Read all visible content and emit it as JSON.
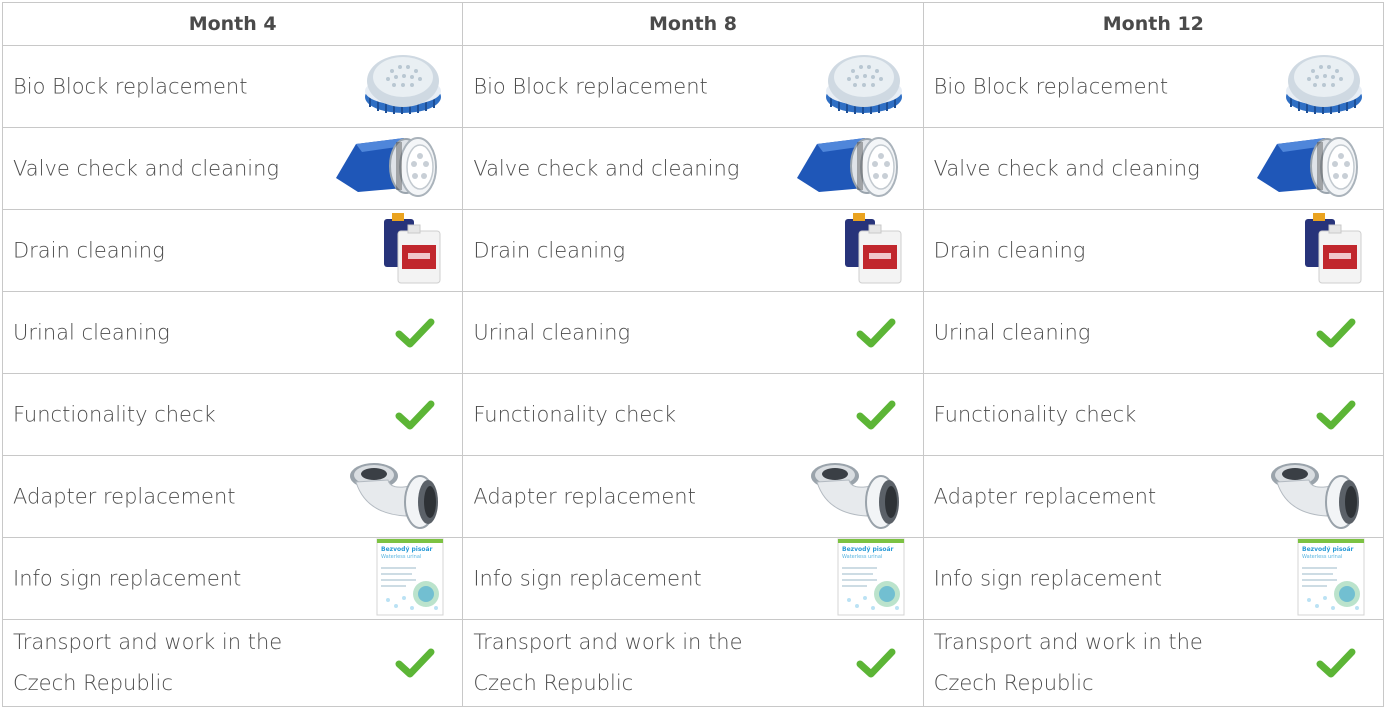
{
  "columns": [
    {
      "header": "Month 4"
    },
    {
      "header": "Month 8"
    },
    {
      "header": "Month 12"
    }
  ],
  "rows": [
    {
      "label": "Bio Block replacement",
      "icon": "bio-block-icon"
    },
    {
      "label": "Valve check and cleaning",
      "icon": "valve-icon"
    },
    {
      "label": "Drain cleaning",
      "icon": "cleaning-canister-icon"
    },
    {
      "label": "Urinal cleaning",
      "icon": "checkmark-icon"
    },
    {
      "label": "Functionality check",
      "icon": "checkmark-icon"
    },
    {
      "label": "Adapter replacement",
      "icon": "adapter-icon"
    },
    {
      "label": "Info sign replacement",
      "icon": "info-sign-icon"
    },
    {
      "label": "Transport and work in the Czech Republic",
      "icon": "checkmark-icon"
    }
  ],
  "info_sign": {
    "title": "Bezvodý pisoár",
    "subtitle": "Waterless urinal"
  },
  "colors": {
    "check": "#5cb536",
    "border": "#c8c8c8",
    "text": "#4d4d4d",
    "bio_block_blue": "#2f6fc4",
    "valve_blue": "#1f57b8",
    "canister_red": "#c1272d"
  }
}
